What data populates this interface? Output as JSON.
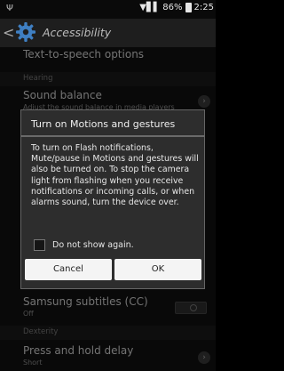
{
  "statusbar": {
    "usb_symbol": "Ψ",
    "signal": "▼▋▌",
    "battery": "86%",
    "time": "2:25"
  },
  "header": {
    "back_glyph": "<",
    "title": "Accessibility"
  },
  "list": {
    "row_tts": "Text-to-speech options",
    "section_hearing": "Hearing",
    "sound_balance": {
      "label": "Sound balance",
      "sub": "Adjust the sound balance in media players"
    },
    "samsung_subtitles": {
      "label": "Samsung subtitles (CC)",
      "sub": "Off"
    },
    "section_dexterity": "Dexterity",
    "press_hold": {
      "label": "Press and hold delay",
      "sub": "Short"
    },
    "chevron_glyph": "›"
  },
  "dialog": {
    "title": "Turn on Motions and gestures",
    "body": "To turn on Flash notifications, Mute/pause in Motions and gestures will also be turned on. To stop the camera light from flashing when you receive notifications or incoming calls, or when alarms sound, turn the device over.",
    "checkbox_label": "Do not show again.",
    "cancel_label": "Cancel",
    "ok_label": "OK"
  },
  "colors": {
    "background": "#121212",
    "dialog": "#2d2d2d",
    "button": "#f4f4f4"
  }
}
